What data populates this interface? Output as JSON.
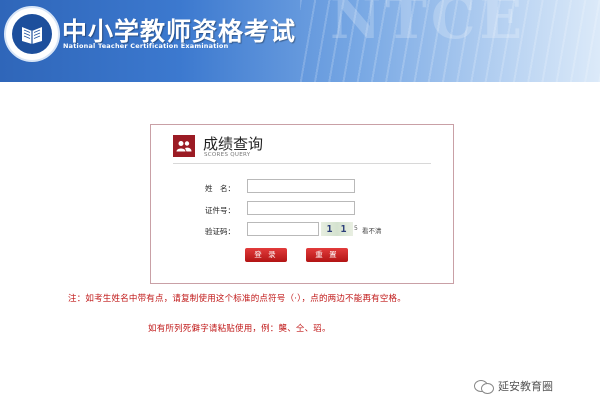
{
  "header": {
    "title": "中小学教师资格考试",
    "subtitle": "National Teacher Certification Examination",
    "watermark": "NTCE"
  },
  "panel": {
    "title": "成绩查询",
    "subtitle": "SCORES QUERY",
    "fields": {
      "name_label": "姓　名：",
      "name_value": "",
      "id_label": "证件号：",
      "id_value": "",
      "captcha_label": "验证码：",
      "captcha_value": ""
    },
    "captcha": {
      "image_text": "1 1",
      "unit": "5",
      "refresh_label": "看不清"
    },
    "buttons": {
      "login": "登 录",
      "reset": "重 置"
    }
  },
  "notes": {
    "line1": "注：如考生姓名中带有点，请复制使用这个标准的点符号（·），点的两边不能再有空格。",
    "line2": "如有所列死僻字请粘贴使用，例：龑、仝、瑫。"
  },
  "footer": {
    "label": "延安教育圈"
  },
  "colors": {
    "banner_blue": "#2f66b9",
    "accent_red": "#c01818",
    "button_red": "#b21414"
  }
}
